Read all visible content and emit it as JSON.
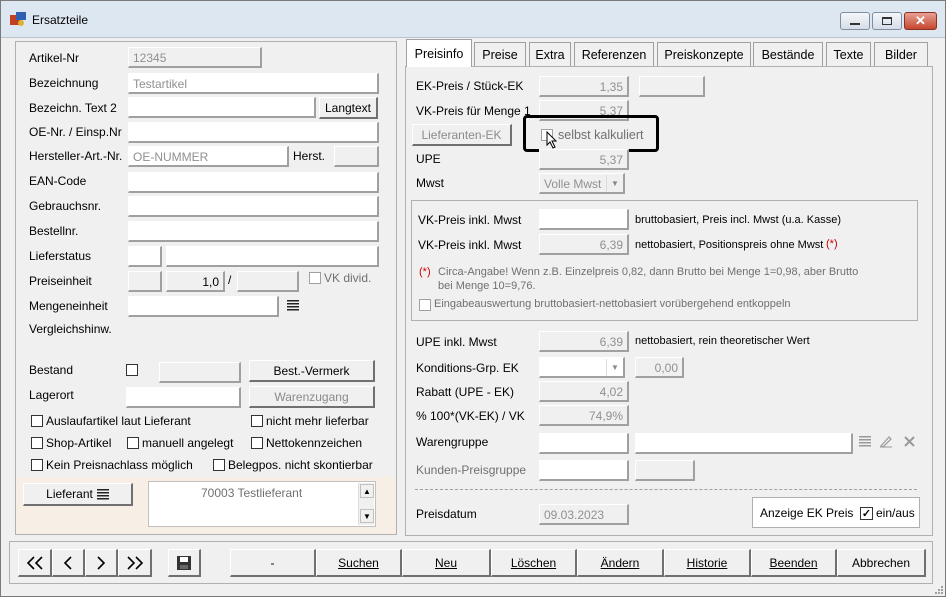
{
  "window": {
    "title": "Ersatzteile"
  },
  "left": {
    "artikel_nr_label": "Artikel-Nr",
    "artikel_nr": "12345",
    "bezeichnung_label": "Bezeichnung",
    "bezeichnung": "Testartikel",
    "bezeichn_text2_label": "Bezeichn. Text 2",
    "langtext_button": "Langtext",
    "oe_nr_label": "OE-Nr. / Einsp.Nr",
    "hersteller_label": "Hersteller-Art.-Nr.",
    "hersteller": "OE-NUMMER",
    "herst_label": "Herst.",
    "ean_label": "EAN-Code",
    "gebrauchsnr_label": "Gebrauchsnr.",
    "bestellnr_label": "Bestellnr.",
    "lieferstatus_label": "Lieferstatus",
    "preiseinheit_label": "Preiseinheit",
    "preiseinheit": "1,0",
    "slash": "/",
    "vk_divid_label": "VK divid.",
    "mengeneinheit_label": "Mengeneinheit",
    "vergleichshinw_label": "Vergleichshinw.",
    "bestand_label": "Bestand",
    "best_vermerk_button": "Best.-Vermerk",
    "lagerort_label": "Lagerort",
    "warenzugang_button": "Warenzugang",
    "auslauf_label": "Auslaufartikel laut Lieferant",
    "nicht_mehr_label": "nicht mehr lieferbar",
    "shop_label": "Shop-Artikel",
    "manuell_label": "manuell angelegt",
    "netto_label": "Nettokennzeichen",
    "kein_nachlass_label": "Kein Preisnachlass möglich",
    "belegpos_label": "Belegpos. nicht skontierbar",
    "lieferant_button": "Lieferant",
    "lieferant_text": "70003 Testlieferant"
  },
  "tabs": [
    {
      "label": "Preisinfo",
      "active": true
    },
    {
      "label": "Preise"
    },
    {
      "label": "Extra"
    },
    {
      "label": "Referenzen"
    },
    {
      "label": "Preiskonzepte"
    },
    {
      "label": "Bestände"
    },
    {
      "label": "Texte"
    },
    {
      "label": "Bilder"
    }
  ],
  "preisinfo": {
    "ek_label": "EK-Preis  / Stück-EK",
    "ek": "1,35",
    "vk_menge_label": "VK-Preis für Menge 1",
    "vk_menge": "5,37",
    "lieferanten_ek_button": "Lieferanten-EK",
    "selbst_kalkuliert_label": "selbst kalkuliert",
    "upe_label": "UPE",
    "upe": "5,37",
    "mwst_label": "Mwst",
    "mwst": "Volle Mwst",
    "vk_inkl1_label": "VK-Preis inkl. Mwst",
    "vk_inkl1_note": "bruttobasiert, Preis incl. Mwst (u.a. Kasse)",
    "vk_inkl2_label": "VK-Preis inkl. Mwst",
    "vk_inkl2": "6,39",
    "vk_inkl2_note": "nettobasiert, Positionspreis ohne Mwst",
    "asterisk": "(*)",
    "circa_line1": "Circa-Angabe! Wenn z.B. Einzelpreis 0,82, dann Brutto bei Menge 1=0,98, aber Brutto",
    "circa_line2": "bei Menge 10=9,76.",
    "entkoppeln_label": "Eingabeauswertung bruttobasiert-nettobasiert vorübergehend entkoppeln",
    "upe_inkl_label": "UPE inkl. Mwst",
    "upe_inkl": "6,39",
    "upe_inkl_note": "nettobasiert, rein theoretischer Wert",
    "konditions_label": "Konditions-Grp. EK",
    "konditions_val": "0,00",
    "rabatt_label": "Rabatt (UPE - EK)",
    "rabatt": "4,02",
    "prozent_label": "% 100*(VK-EK) / VK",
    "prozent": "74,9%",
    "warengruppe_label": "Warengruppe",
    "kunden_preisgruppe_label": "Kunden-Preisgruppe",
    "preisdatum_label": "Preisdatum",
    "preisdatum": "09.03.2023",
    "anzeige_ek_label": "Anzeige EK Preis",
    "ein_aus_label": "ein/aus"
  },
  "bottom": {
    "dash": "-",
    "suchen": "Suchen",
    "neu": "Neu",
    "loeschen": "Löschen",
    "aendern": "Ändern",
    "historie": "Historie",
    "beenden": "Beenden",
    "abbrechen": "Abbrechen"
  }
}
